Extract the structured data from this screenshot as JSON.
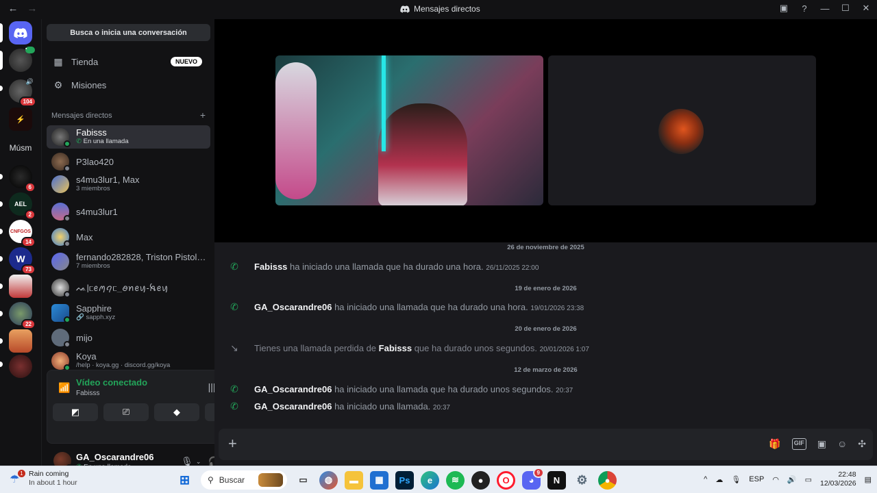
{
  "window": {
    "title": "Mensajes directos"
  },
  "search": {
    "placeholder": "Busca o inicia una conversación"
  },
  "nav": {
    "store": {
      "label": "Tienda",
      "badge": "NUEVO"
    },
    "quests": {
      "label": "Misiones"
    }
  },
  "dm_header": {
    "label": "Mensajes directos",
    "add": "+"
  },
  "servers": {
    "label_text": "Músm",
    "badges": [
      "104",
      "6",
      "2",
      "14",
      "73",
      "22"
    ],
    "ael": "AEL",
    "cnfgos": "CNFGOS"
  },
  "dms": [
    {
      "name": "Fabisss",
      "sub": "En una llamada"
    },
    {
      "name": "P3lao420",
      "sub": ""
    },
    {
      "name": "s4mu3lur1, Max",
      "sub": "3 miembros"
    },
    {
      "name": "s4mu3lur1",
      "sub": ""
    },
    {
      "name": "Max",
      "sub": ""
    },
    {
      "name": "fernando282828, Triston Pistolero",
      "sub": "7 miembros"
    },
    {
      "name": "ᨕ|ᥴꫀꪑꪖᥴ_ꪮꪀꫀꪗ-ꫝꫀꪗ",
      "sub": ""
    },
    {
      "name": "Sapphire",
      "sub": "sapph.xyz"
    },
    {
      "name": "mijo",
      "sub": ""
    },
    {
      "name": "Koya",
      "sub": "/help · koya.gg · discord.gg/koya"
    }
  ],
  "voice": {
    "title": "Vídeo conectado",
    "channel": "Fabisss"
  },
  "user": {
    "name": "GA_Oscarandre06",
    "status": "En una llamada"
  },
  "messages": [
    {
      "divider": "26 de noviembre de 2025"
    },
    {
      "name": "Fabisss",
      "text": "ha iniciado una llamada que ha durado una hora.",
      "time": "26/11/2025 22:00"
    },
    {
      "divider": "19 de enero de 2026"
    },
    {
      "name": "GA_Oscarandre06",
      "text": "ha iniciado una llamada que ha durado una hora.",
      "time": "19/01/2026 23:38"
    },
    {
      "divider": "20 de enero de 2026"
    },
    {
      "prefix": "Tienes una llamada perdida de",
      "name": "Fabisss",
      "text": "que ha durado unos segundos.",
      "time": "20/01/2026 1:07"
    },
    {
      "divider": "12 de marzo de 2026"
    },
    {
      "name": "GA_Oscarandre06",
      "text": "ha iniciado una llamada que ha durado unos segundos.",
      "time": "20:37"
    },
    {
      "name": "GA_Oscarandre06",
      "text": "ha iniciado una llamada.",
      "time": "20:37"
    }
  ],
  "taskbar": {
    "weather": {
      "title": "Rain coming",
      "sub": "In about 1 hour",
      "badge": "1"
    },
    "search": "Buscar",
    "lang": "ESP",
    "time": "22:48",
    "date": "12/03/2026",
    "discord_badge": "9"
  },
  "colors": {
    "accent": "#5865f2",
    "online": "#23a55a",
    "danger": "#da373c"
  }
}
